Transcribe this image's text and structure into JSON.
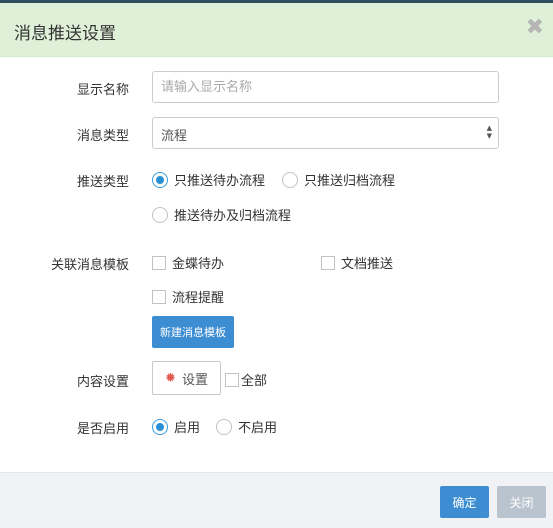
{
  "dialog": {
    "title": "消息推送设置",
    "close_glyph": "✖"
  },
  "fields": {
    "display_name": {
      "label": "显示名称",
      "placeholder": "请输入显示名称",
      "value": ""
    },
    "message_type": {
      "label": "消息类型",
      "selected": "流程"
    },
    "push_type": {
      "label": "推送类型",
      "options": [
        {
          "label": "只推送待办流程",
          "checked": true
        },
        {
          "label": "只推送归档流程",
          "checked": false
        },
        {
          "label": "推送待办及归档流程",
          "checked": false
        }
      ]
    },
    "templates": {
      "label": "关联消息模板",
      "options": [
        {
          "label": "金蝶待办",
          "checked": false
        },
        {
          "label": "文档推送",
          "checked": false
        },
        {
          "label": "流程提醒",
          "checked": false
        }
      ],
      "new_button": "新建消息模板"
    },
    "content": {
      "label": "内容设置",
      "setting_button": "设置",
      "all_label": "全部"
    },
    "enabled": {
      "label": "是否启用",
      "options": [
        {
          "label": "启用",
          "checked": true
        },
        {
          "label": "不启用",
          "checked": false
        }
      ]
    }
  },
  "footer": {
    "ok": "确定",
    "close": "关闭"
  },
  "colors": {
    "header_bg": "#dff0d8",
    "primary": "#3c8dd2",
    "disabled": "#b9c4ce",
    "gear": "#e05a4f"
  }
}
